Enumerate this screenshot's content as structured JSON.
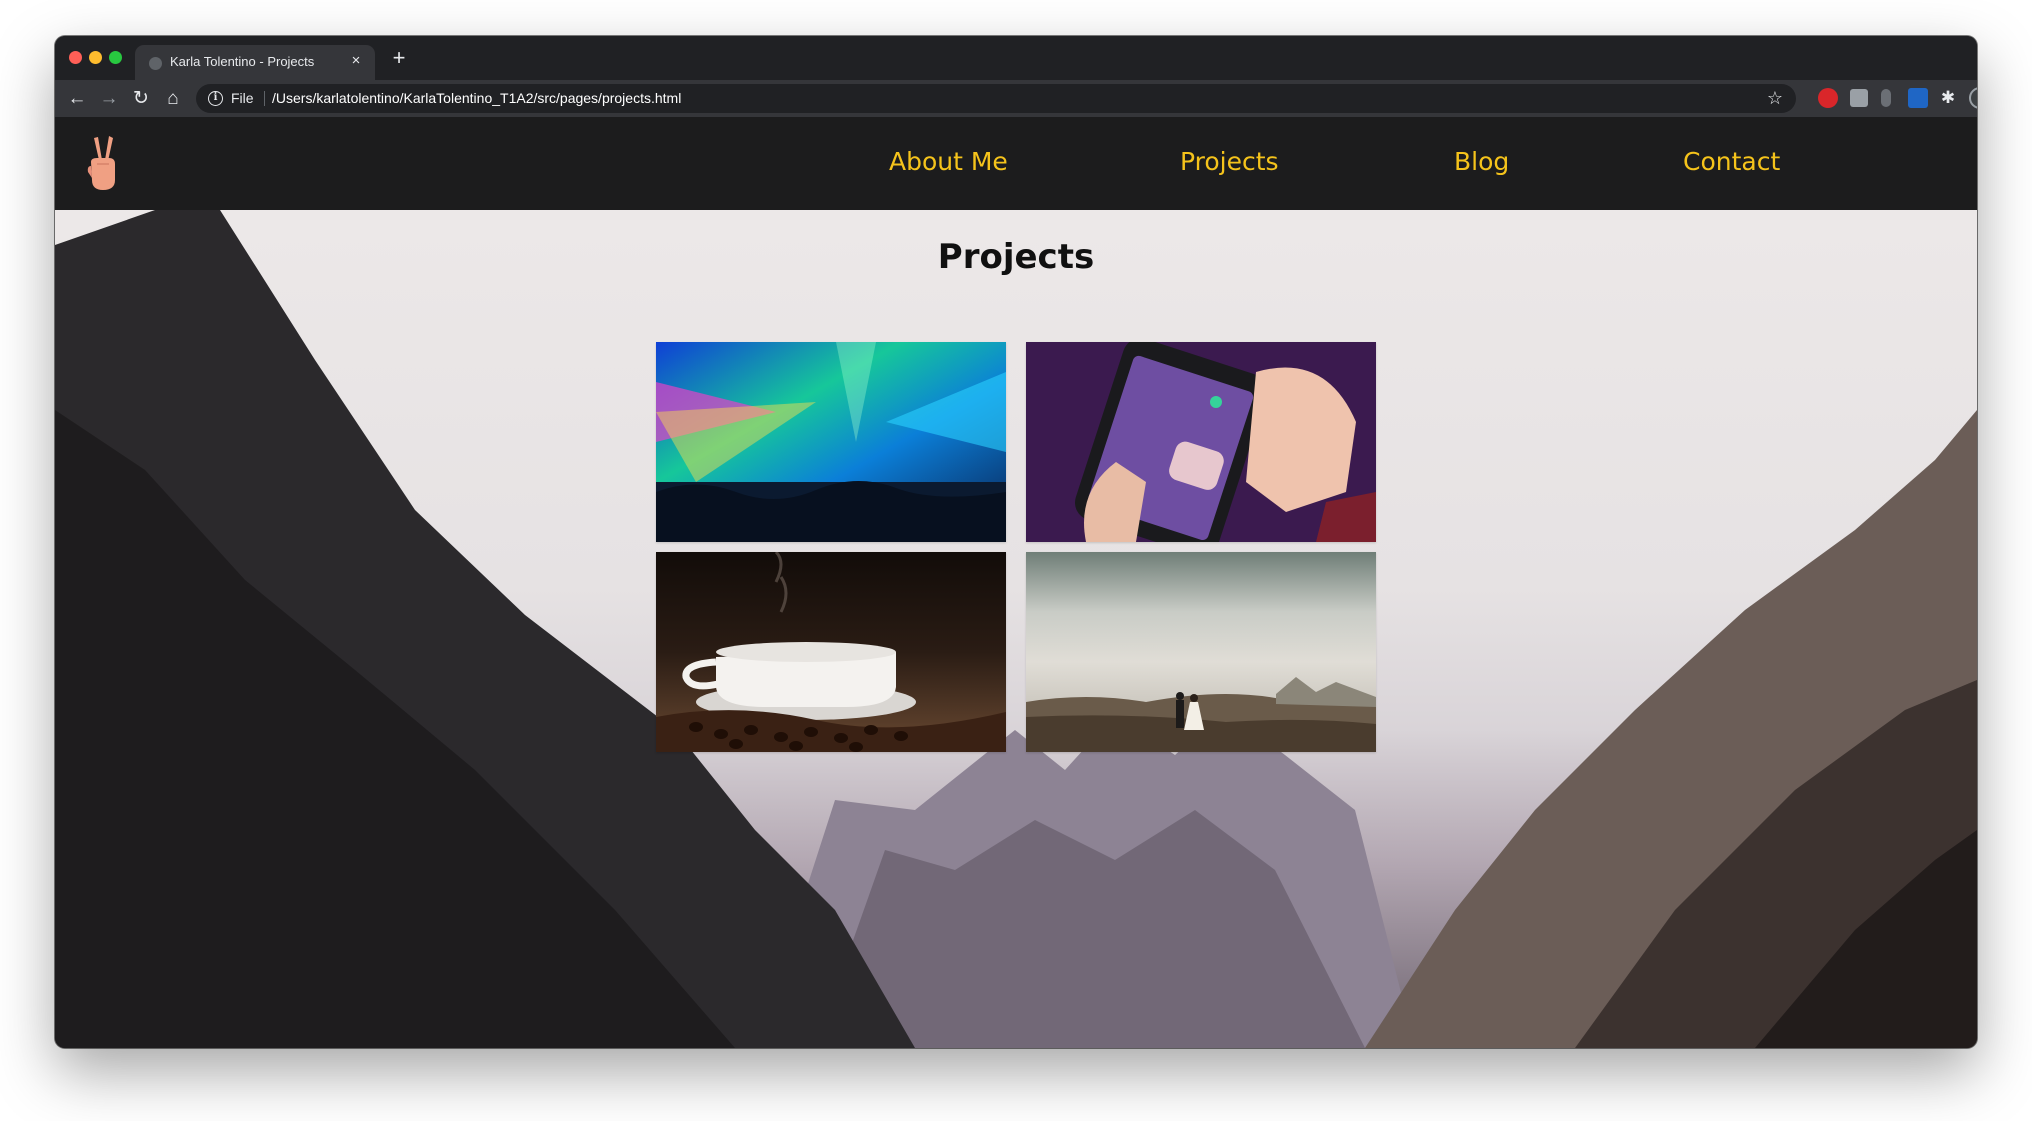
{
  "browser": {
    "tab_title": "Karla Tolentino - Projects",
    "tab_close": "×",
    "new_tab": "+",
    "back": "←",
    "forward": "→",
    "reload": "↻",
    "home": "⌂",
    "info": "i",
    "scheme": "File",
    "url": "/Users/karlatolentino/KarlaTolentino_T1A2/src/pages/projects.html",
    "bookmark": "☆",
    "extensions_icon": "✱"
  },
  "site": {
    "logo_icon": "peace-hand-emoji",
    "nav": {
      "about": "About Me",
      "projects": "Projects",
      "blog": "Blog",
      "contact": "Contact"
    },
    "accent_color": "#f5c31b",
    "nav_background": "#1c1c1d"
  },
  "main": {
    "title": "Projects",
    "background": "mountain-valley-photo",
    "projects": [
      {
        "image": "concert-lights-photo"
      },
      {
        "image": "phone-app-photo"
      },
      {
        "image": "coffee-cup-photo"
      },
      {
        "image": "couple-landscape-photo"
      }
    ]
  }
}
